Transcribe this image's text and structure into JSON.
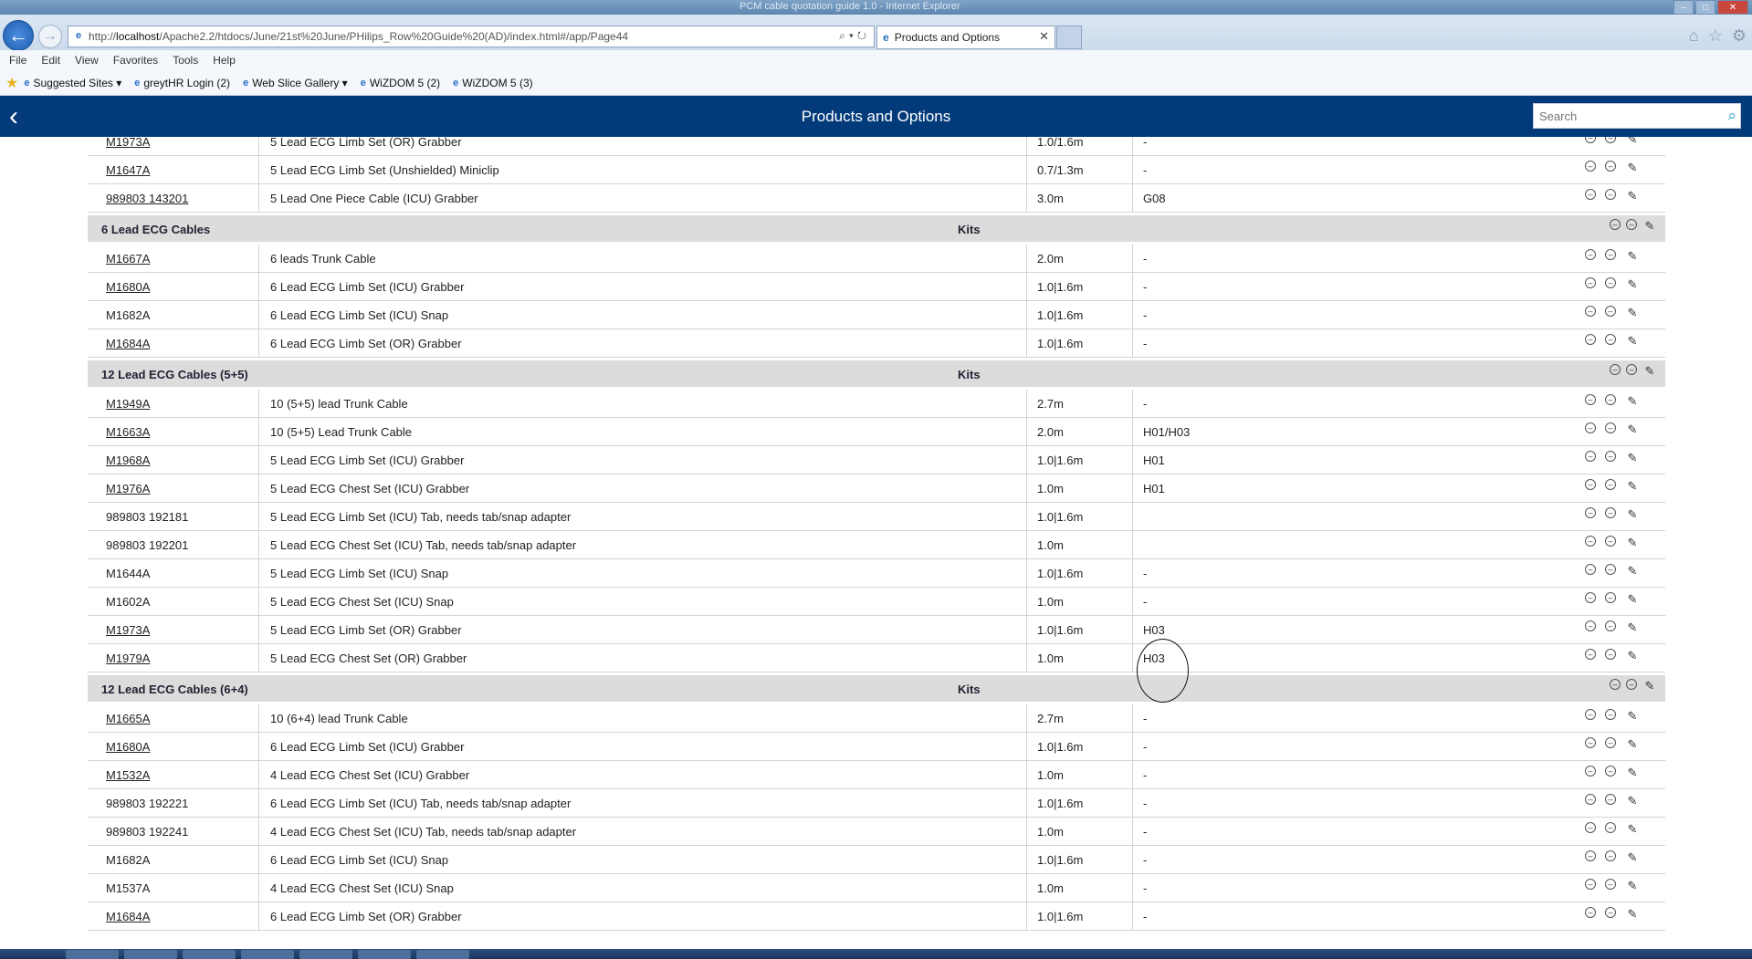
{
  "browser": {
    "window_title": "PCM cable quotation guide 1.0 - Internet Explorer",
    "url_prefix": "http://",
    "url_host": "localhost",
    "url_path": "/Apache2.2/htdocs/June/21st%20June/PHilips_Row%20Guide%20(AD)/index.html#/app/Page44",
    "tab_title": "Products and Options",
    "menu": [
      "File",
      "Edit",
      "View",
      "Favorites",
      "Tools",
      "Help"
    ],
    "favorites": [
      "Suggested Sites ▾",
      "greytHR Login (2)",
      "Web Slice Gallery ▾",
      "WiZDOM 5 (2)",
      "WiZDOM 5 (3)"
    ]
  },
  "app": {
    "title": "Products and Options",
    "search_placeholder": "Search"
  },
  "sections": [
    {
      "title": "",
      "kits": "",
      "rows": [
        {
          "code": "M1973A",
          "link": true,
          "desc": "5 Lead ECG Limb Set (OR) Grabber",
          "len": "1.0/1.6m",
          "opt": "-"
        },
        {
          "code": "M1647A",
          "link": true,
          "desc": "5 Lead ECG Limb Set (Unshielded) Miniclip",
          "len": "0.7/1.3m",
          "opt": "-"
        },
        {
          "code": "989803 143201",
          "link": true,
          "desc": "5 Lead One Piece Cable (ICU) Grabber",
          "len": "3.0m",
          "opt": "G08"
        }
      ]
    },
    {
      "title": "6 Lead ECG Cables",
      "kits": "Kits",
      "rows": [
        {
          "code": "M1667A",
          "link": true,
          "desc": "6 leads Trunk Cable",
          "len": "2.0m",
          "opt": "-"
        },
        {
          "code": "M1680A",
          "link": true,
          "desc": "6 Lead ECG Limb Set (ICU) Grabber",
          "len": "1.0|1.6m",
          "opt": "-"
        },
        {
          "code": "M1682A",
          "link": false,
          "desc": "6 Lead ECG Limb Set (ICU) Snap",
          "len": "1.0|1.6m",
          "opt": "-"
        },
        {
          "code": "M1684A",
          "link": true,
          "desc": "6 Lead ECG Limb Set (OR) Grabber",
          "len": "1.0|1.6m",
          "opt": "-"
        }
      ]
    },
    {
      "title": "12 Lead ECG Cables (5+5)",
      "kits": "Kits",
      "rows": [
        {
          "code": "M1949A",
          "link": true,
          "desc": "10 (5+5) lead Trunk Cable",
          "len": "2.7m",
          "opt": "-"
        },
        {
          "code": "M1663A",
          "link": true,
          "desc": "10 (5+5) Lead Trunk Cable",
          "len": "2.0m",
          "opt": "H01/H03"
        },
        {
          "code": "M1968A",
          "link": true,
          "desc": "5 Lead ECG Limb Set (ICU) Grabber",
          "len": "1.0|1.6m",
          "opt": "H01"
        },
        {
          "code": "M1976A",
          "link": true,
          "desc": "5 Lead ECG Chest Set (ICU) Grabber",
          "len": "1.0m",
          "opt": "H01"
        },
        {
          "code": "989803 192181",
          "link": false,
          "desc": "5 Lead ECG Limb Set (ICU) Tab, needs tab/snap adapter",
          "len": "1.0|1.6m",
          "opt": ""
        },
        {
          "code": "989803 192201",
          "link": false,
          "desc": "5 Lead ECG Chest Set (ICU) Tab, needs tab/snap adapter",
          "len": "1.0m",
          "opt": ""
        },
        {
          "code": "M1644A",
          "link": false,
          "desc": "5 Lead ECG Limb Set (ICU) Snap",
          "len": "1.0|1.6m",
          "opt": "-"
        },
        {
          "code": "M1602A",
          "link": false,
          "desc": "5 Lead ECG Chest Set (ICU) Snap",
          "len": "1.0m",
          "opt": "-"
        },
        {
          "code": "M1973A",
          "link": true,
          "desc": "5 Lead ECG Limb Set (OR) Grabber",
          "len": "1.0|1.6m",
          "opt": "H03"
        },
        {
          "code": "M1979A",
          "link": true,
          "desc": "5 Lead ECG Chest Set (OR) Grabber",
          "len": "1.0m",
          "opt": "H03"
        }
      ]
    },
    {
      "title": "12 Lead ECG Cables (6+4)",
      "kits": "Kits",
      "rows": [
        {
          "code": "M1665A",
          "link": true,
          "desc": "10 (6+4) lead Trunk Cable",
          "len": "2.7m",
          "opt": "-"
        },
        {
          "code": "M1680A",
          "link": true,
          "desc": "6 Lead ECG Limb Set (ICU) Grabber",
          "len": "1.0|1.6m",
          "opt": "-"
        },
        {
          "code": "M1532A",
          "link": true,
          "desc": "4 Lead ECG Chest Set (ICU) Grabber",
          "len": "1.0m",
          "opt": "-"
        },
        {
          "code": "989803 192221",
          "link": false,
          "desc": "6 Lead ECG Limb Set (ICU) Tab, needs tab/snap adapter",
          "len": "1.0|1.6m",
          "opt": "-"
        },
        {
          "code": "989803 192241",
          "link": false,
          "desc": "4 Lead ECG Chest Set (ICU) Tab, needs tab/snap adapter",
          "len": "1.0m",
          "opt": "-"
        },
        {
          "code": "M1682A",
          "link": false,
          "desc": "6 Lead ECG Limb Set (ICU) Snap",
          "len": "1.0|1.6m",
          "opt": "-"
        },
        {
          "code": "M1537A",
          "link": false,
          "desc": "4 Lead ECG Chest Set (ICU) Snap",
          "len": "1.0m",
          "opt": "-"
        },
        {
          "code": "M1684A",
          "link": true,
          "desc": "6 Lead ECG Limb Set (OR) Grabber",
          "len": "1.0|1.6m",
          "opt": "-"
        }
      ]
    }
  ],
  "icons": {
    "remove": "minus-circle-icon",
    "edit": "edit-icon"
  },
  "colors": {
    "header": "#033b7a",
    "section_bg": "#dcdcdc"
  }
}
